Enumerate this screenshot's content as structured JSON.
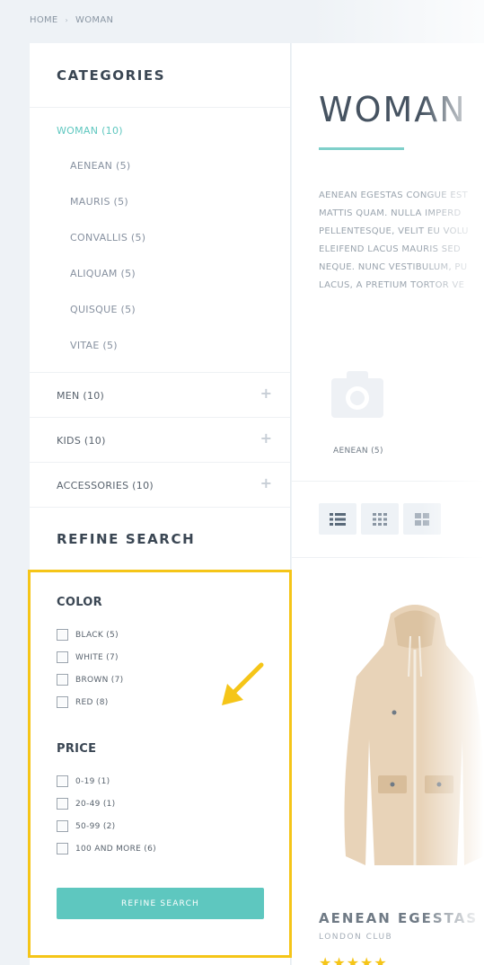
{
  "breadcrumb": {
    "home": "HOME",
    "current": "WOMAN"
  },
  "sidebar": {
    "categories_title": "CATEGORIES",
    "active_category": "WOMAN (10)",
    "subcategories": [
      "AENEAN (5)",
      "MAURIS (5)",
      "CONVALLIS (5)",
      "ALIQUAM (5)",
      "QUISQUE (5)",
      "VITAE (5)"
    ],
    "categories": [
      "MEN (10)",
      "KIDS (10)",
      "ACCESSORIES (10)"
    ],
    "refine_title": "REFINE SEARCH",
    "color_title": "COLOR",
    "colors": [
      "BLACK (5)",
      "WHITE (7)",
      "BROWN (7)",
      "RED (8)"
    ],
    "price_title": "PRICE",
    "prices": [
      "0-19 (1)",
      "20-49 (1)",
      "50-99 (2)",
      "100 AND MORE (6)"
    ],
    "refine_button": "REFINE SEARCH"
  },
  "main": {
    "title": "WOMAN",
    "description": [
      "AENEAN EGESTAS CONGUE EST",
      "MATTIS QUAM. NULLA IMPERD",
      "PELLENTESQUE, VELIT EU VOLU",
      "ELEIFEND LACUS MAURIS SED",
      "NEQUE. NUNC VESTIBULUM, PU",
      "LACUS, A PRETIUM TORTOR VE"
    ],
    "subcategory_card": "AENEAN (5)",
    "product_name": "AENEAN EGESTAS",
    "product_brand": "LONDON CLUB",
    "product_stars": "★★★★★"
  },
  "colors": {
    "accent": "#5ec7bf",
    "highlight": "#f5c518"
  }
}
